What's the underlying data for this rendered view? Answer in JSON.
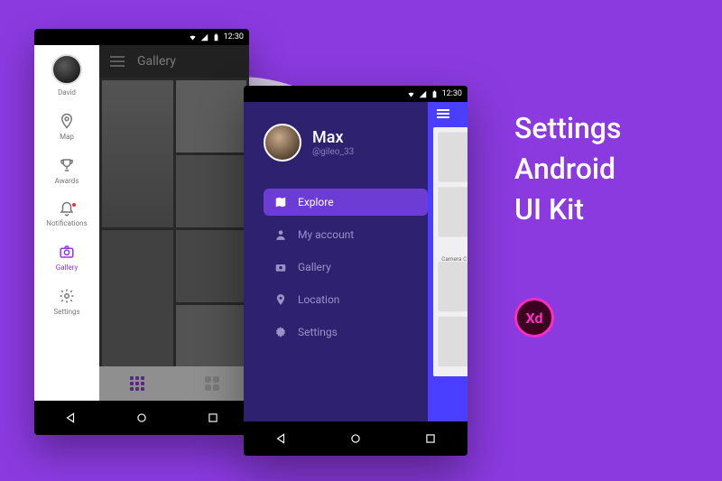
{
  "statusbar": {
    "time": "12:30"
  },
  "phone1": {
    "username": "David",
    "header_title": "Gallery",
    "sidebar": [
      {
        "label": "David",
        "icon": "avatar"
      },
      {
        "label": "Map",
        "icon": "pin"
      },
      {
        "label": "Awards",
        "icon": "trophy"
      },
      {
        "label": "Notifications",
        "icon": "bell",
        "dot": true
      },
      {
        "label": "Gallery",
        "icon": "camera",
        "active": true
      },
      {
        "label": "Settings",
        "icon": "gear"
      }
    ]
  },
  "phone2": {
    "user_name": "Max",
    "user_handle": "@gileo_33",
    "peek_label": "Camera C",
    "menu": [
      {
        "label": "Explore",
        "icon": "map",
        "active": true
      },
      {
        "label": "My account",
        "icon": "person"
      },
      {
        "label": "Gallery",
        "icon": "camera"
      },
      {
        "label": "Location",
        "icon": "pin"
      },
      {
        "label": "Settings",
        "icon": "gear"
      }
    ]
  },
  "promo": {
    "line1": "Settings",
    "line2": "Android",
    "line3": "UI Kit",
    "badge": "Xd"
  }
}
